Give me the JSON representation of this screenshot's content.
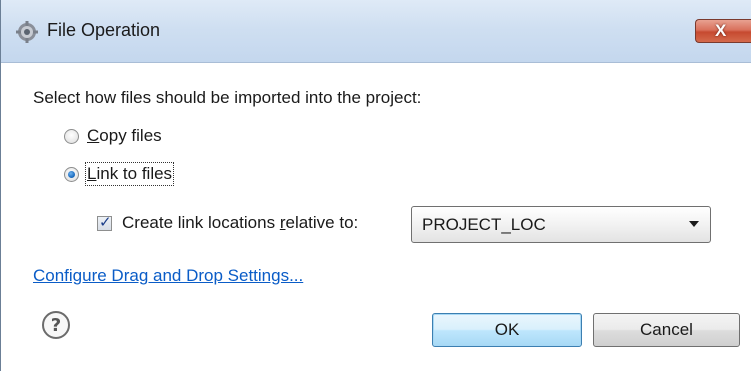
{
  "window": {
    "title": "File Operation",
    "close_label": "X",
    "icon": "eclipse-gear-icon"
  },
  "prompt": "Select how files should be imported into the project:",
  "options": {
    "copy": {
      "accesskey": "C",
      "rest": "opy files",
      "checked": false
    },
    "link": {
      "accesskey": "L",
      "rest": "ink to files",
      "checked": true
    }
  },
  "relative": {
    "checked": true,
    "label_pre": "Create link locations ",
    "label_accesskey": "r",
    "label_post": "elative to:",
    "selected": "PROJECT_LOC"
  },
  "link_text": "Configure Drag and Drop Settings...",
  "help_icon": "question-mark-icon",
  "buttons": {
    "ok": "OK",
    "cancel": "Cancel"
  },
  "colors": {
    "link": "#0a5cc7",
    "titlebar": "#cfdff1",
    "close": "#c64a30",
    "ok_border": "#3c7fb1"
  }
}
